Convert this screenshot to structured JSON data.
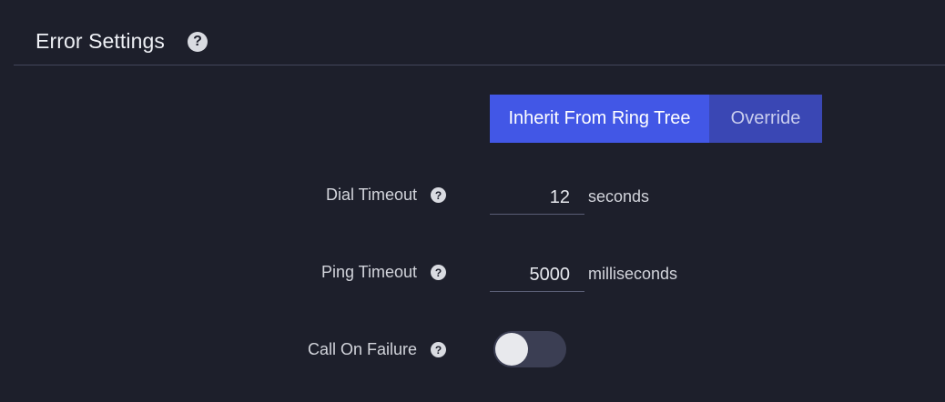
{
  "section": {
    "title": "Error Settings",
    "help_icon": "question-circle-icon"
  },
  "mode_toggle": {
    "options": [
      "Inherit From Ring Tree",
      "Override"
    ],
    "selected": "Inherit From Ring Tree"
  },
  "fields": {
    "dial_timeout": {
      "label": "Dial Timeout",
      "value": "12",
      "unit": "seconds"
    },
    "ping_timeout": {
      "label": "Ping Timeout",
      "value": "5000",
      "unit": "milliseconds"
    },
    "call_on_failure": {
      "label": "Call On Failure",
      "enabled": false
    }
  },
  "colors": {
    "background": "#1d1f2b",
    "accent_active": "#4257e6",
    "accent_inactive": "#3a47b4",
    "toggle_track": "#3b3e53"
  }
}
